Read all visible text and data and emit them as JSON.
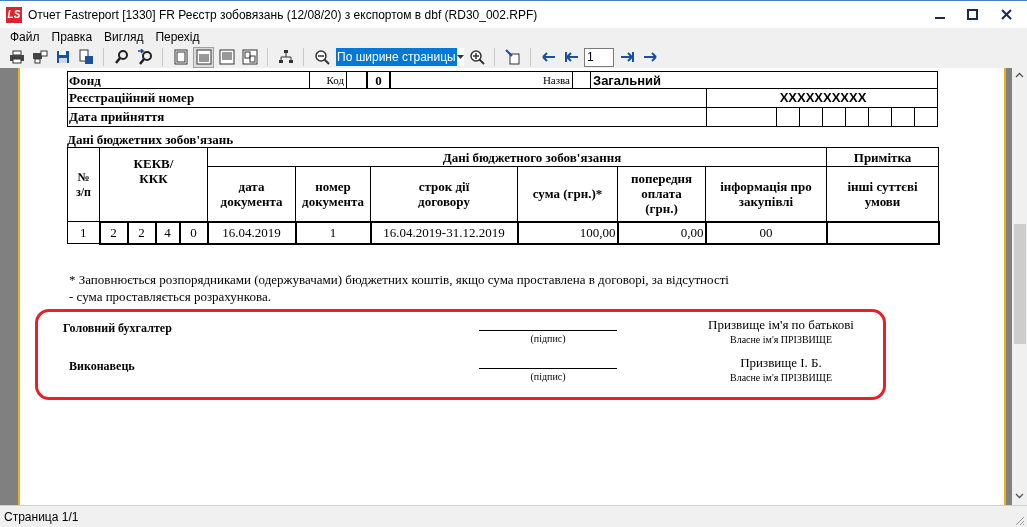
{
  "window": {
    "logo_text": "LS",
    "title": "Отчет Fastreport [1330] FR Реєстр зобовязань (12/08/20) з експортом в dbf (RD30_002.RPF)"
  },
  "menu": [
    "Файл",
    "Правка",
    "Вигляд",
    "Перехід"
  ],
  "toolbar": {
    "view_modes": [
      {
        "kind": "page",
        "selected": false
      },
      {
        "kind": "width",
        "selected": true
      },
      {
        "kind": "lines",
        "selected": false
      },
      {
        "kind": "two",
        "selected": false
      }
    ],
    "zoom_select": {
      "value": "По ширине страницы"
    },
    "page_field": {
      "value": "1"
    }
  },
  "report": {
    "fund": {
      "label": "Фонд",
      "code_label": "Код",
      "code": "0",
      "name_label": "Назва",
      "name": "Загальний"
    },
    "registration": {
      "label": "Реєстраційний номер",
      "value": "XXXXXXXXXX"
    },
    "adoption_date": {
      "label": "Дата прийняття"
    },
    "section_title": "Дані бюджетних зобов'язань",
    "table": {
      "group_header": "Дані  бюджетного зобов'язання",
      "note_header": "Примітка",
      "columns": [
        {
          "label": "№\nз/п"
        },
        {
          "label": "КЕКВ/\nККК",
          "colspan": 4
        },
        {
          "label": "дата\nдокумента"
        },
        {
          "label": "номер\nдокумента"
        },
        {
          "label": "строк дії\nдоговору"
        },
        {
          "label": "сума  (грн.)*"
        },
        {
          "label": "попередня\nоплата\n(грн.)"
        },
        {
          "label": "інформація про\nзакупівлі"
        },
        {
          "label": "інші суттєві\nумови"
        }
      ],
      "rows": [
        {
          "cells": [
            "1",
            "2",
            "2",
            "4",
            "0",
            "16.04.2019",
            "1",
            "16.04.2019-31.12.2019",
            "100,00",
            "0,00",
            "00",
            ""
          ]
        }
      ]
    },
    "footnote": [
      "* Заповнюється розпорядниками (одержувачами) бюджетних коштів, якщо сума проставлена в договорі, за відсутності",
      "- сума проставляється розрахункова."
    ],
    "signatures": [
      {
        "role": "Головний бухгалтер",
        "sign_caption": "(підпис)",
        "name": "Призвище ім'я по батькові",
        "name_caption": "Власне ім'я ПРІЗВИЩЕ"
      },
      {
        "role": "Виконавець",
        "sign_caption": "(підпис)",
        "name": "Призвище І. Б.",
        "name_caption": "Власне ім'я ПРІЗВИЩЕ"
      }
    ]
  },
  "status_bar": "Страница 1/1"
}
